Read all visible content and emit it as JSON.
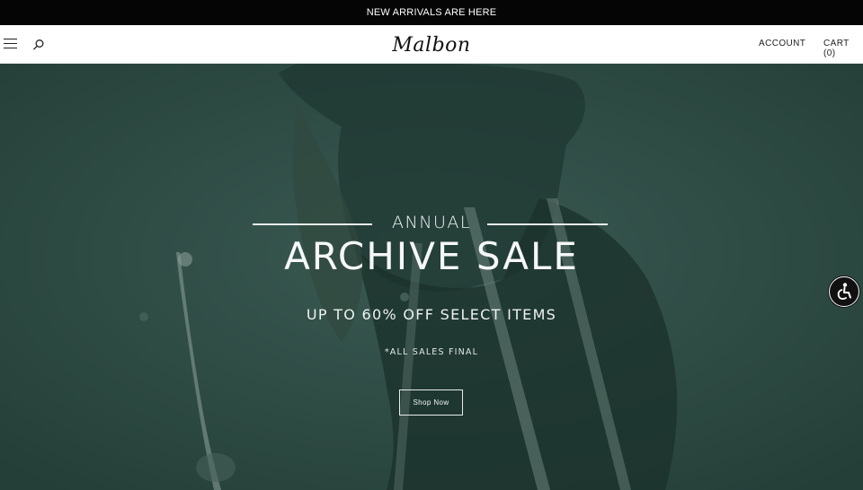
{
  "announcement": {
    "text": "NEW ARRIVALS ARE HERE"
  },
  "header": {
    "logo_text": "Malbon",
    "account_label": "ACCOUNT",
    "cart_label": "CART (0)",
    "menu_icon": "hamburger-menu-icon",
    "search_icon": "search-icon"
  },
  "hero": {
    "eyebrow": "ANNUAL",
    "title": "ARCHIVE SALE",
    "subtitle": "UP TO 60% OFF SELECT ITEMS",
    "fine_print": "*ALL SALES FINAL",
    "cta_label": "Shop Now",
    "background_color": "#2a4a42"
  },
  "accessibility": {
    "icon": "accessibility-icon"
  },
  "colors": {
    "announcement_bg": "#050505",
    "hero_overlay": "#2a4a42",
    "text_light": "#f6f8f7"
  }
}
